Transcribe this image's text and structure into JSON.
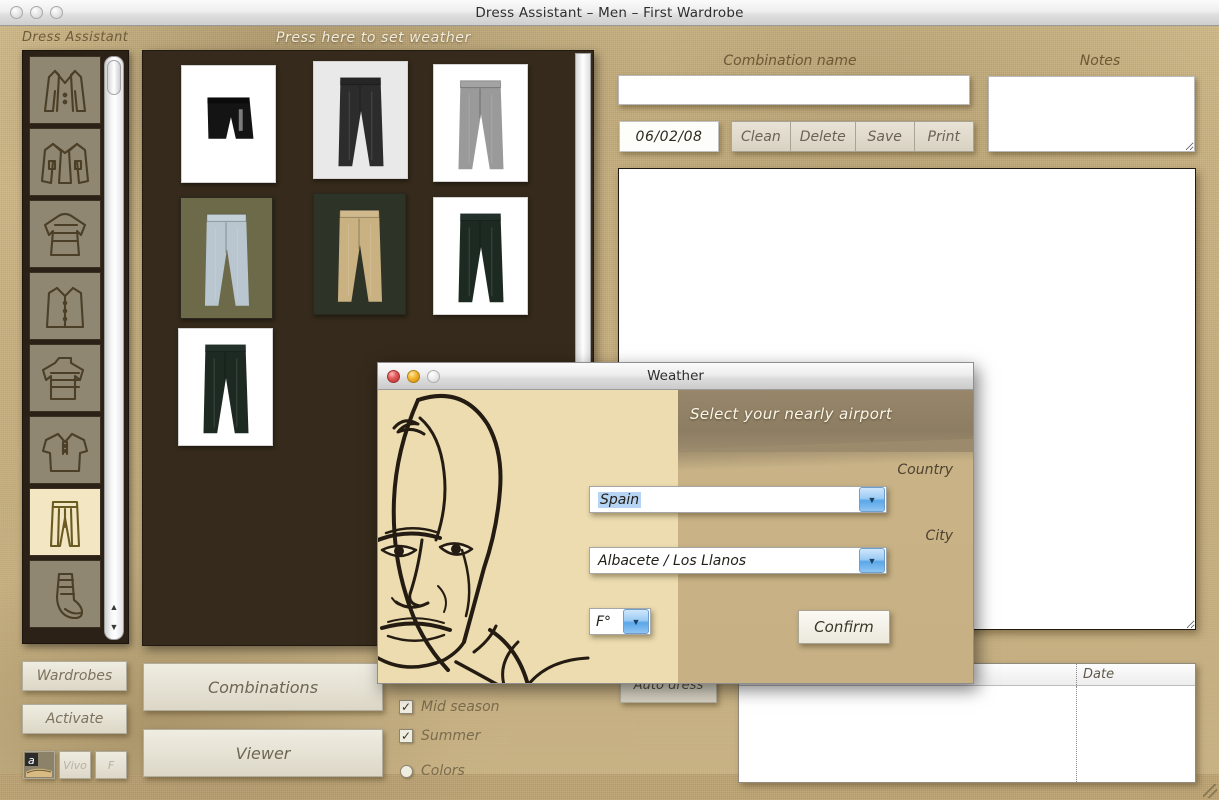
{
  "window": {
    "title": "Dress Assistant – Men – First Wardrobe",
    "lights": [
      "close-disabled",
      "minimize-disabled",
      "zoom-disabled"
    ]
  },
  "header": {
    "app_label": "Dress Assistant",
    "weather_hint": "Press here to set weather"
  },
  "sidebar": {
    "name": "clothing-category-list",
    "items": [
      {
        "icon": "suit-jacket-icon",
        "label": "Suit jacket",
        "selected": false
      },
      {
        "icon": "jacket-icon",
        "label": "Jacket",
        "selected": false
      },
      {
        "icon": "sweater-icon",
        "label": "Sweater",
        "selected": false
      },
      {
        "icon": "shirt-icon",
        "label": "Shirt",
        "selected": false
      },
      {
        "icon": "long-sleeve-icon",
        "label": "Long sleeve top",
        "selected": false
      },
      {
        "icon": "polo-icon",
        "label": "Polo shirt",
        "selected": false
      },
      {
        "icon": "trousers-icon",
        "label": "Trousers",
        "selected": true
      },
      {
        "icon": "sock-icon",
        "label": "Socks",
        "selected": false
      }
    ]
  },
  "grid": {
    "name": "wardrobe-item-grid",
    "items": [
      {
        "kind": "shorts-black",
        "style": "white"
      },
      {
        "kind": "pants-black",
        "style": "white"
      },
      {
        "kind": "pants-grey-cargo",
        "style": "white"
      },
      {
        "kind": "jeans-light-blue",
        "style": "photo"
      },
      {
        "kind": "pants-khaki",
        "style": "photo"
      },
      {
        "kind": "pants-dark-green",
        "style": "white"
      },
      {
        "kind": "pants-dark-green-2",
        "style": "white"
      }
    ]
  },
  "right_panel": {
    "combination_name_label": "Combination name",
    "combination_name_value": "",
    "combination_name_placeholder": "",
    "notes_label": "Notes",
    "notes_value": "",
    "date_value": "06/02/08",
    "buttons": [
      {
        "label": "Clean"
      },
      {
        "label": "Delete"
      },
      {
        "label": "Save"
      },
      {
        "label": "Print"
      }
    ],
    "description_value": ""
  },
  "bottom": {
    "wardrobes_label": "Wardrobes",
    "activate_label": "Activate",
    "combinations_label": "Combinations",
    "viewer_label": "Viewer",
    "auto_dress_label": "Auto dress",
    "mini_buttons": [
      {
        "icon": "amazon-icon",
        "label": ""
      },
      {
        "icon": "vivo-icon",
        "label": "Vivo"
      },
      {
        "icon": "f-icon",
        "label": "F"
      }
    ],
    "checkboxes": [
      {
        "label": "Mid season",
        "checked": true,
        "type": "checkbox",
        "mark": "✓"
      },
      {
        "label": "Summer",
        "checked": true,
        "type": "checkbox",
        "mark": "✓"
      },
      {
        "label": "Colors",
        "checked": false,
        "type": "radio",
        "mark": ""
      }
    ]
  },
  "table": {
    "columns": [
      "",
      "Date"
    ],
    "rows": []
  },
  "dialog": {
    "title": "Weather",
    "lights": [
      "close",
      "minimize",
      "zoom-disabled"
    ],
    "heading": "Select your nearly airport",
    "country_label": "Country",
    "country_value": "Spain",
    "city_label": "City",
    "city_value": "Albacete / Los Llanos",
    "unit_value": "F°",
    "confirm_label": "Confirm",
    "portrait": "man-face-sketch"
  },
  "colors": {
    "paper": "#cbb382",
    "panel_dark": "#352a1b",
    "accent_blue": "#5aa7e8",
    "selection_blue": "#b6d4f3",
    "selected_category": "#f2e6c3",
    "ink": "#4c3f28"
  }
}
